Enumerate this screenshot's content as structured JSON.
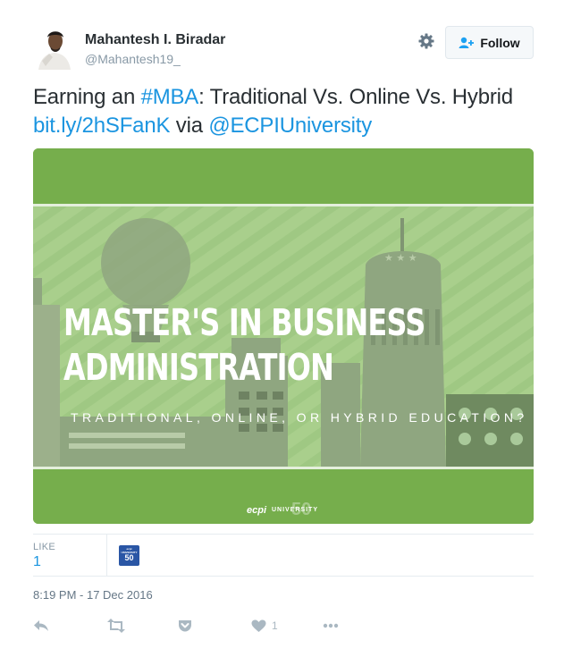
{
  "user": {
    "name": "Mahantesh I. Biradar",
    "handle": "@Mahantesh19_"
  },
  "header": {
    "follow_label": "Follow",
    "settings_icon": "gear-icon",
    "follow_icon": "add-user-icon"
  },
  "tweet": {
    "text_1": "Earning an ",
    "hashtag": "#MBA",
    "text_2": ": Traditional Vs. Online Vs. Hybrid ",
    "url": "bit.ly/2hSFanK",
    "text_3": " via ",
    "mention": "@ECPIUniversity"
  },
  "card": {
    "title_line1": "MASTER'S IN BUSINESS",
    "title_line2": "ADMINISTRATION",
    "subtitle": "TRADITIONAL, ONLINE, OR HYBRID EDUCATION?",
    "brand": "ecpi",
    "brand_sub": "UNIVERSITY",
    "brand_50": "50",
    "bg_color": "#76ae4c",
    "panel_color": "#a7cf8b"
  },
  "stats": {
    "like_label": "LIKE",
    "like_count": "1",
    "liker_badge_text": "ecpi UNIVERSITY",
    "liker_badge": "50"
  },
  "timestamp": "8:19 PM - 17 Dec 2016",
  "actions": {
    "reply_icon": "reply-icon",
    "retweet_icon": "retweet-icon",
    "pocket_icon": "pocket-icon",
    "like_icon": "heart-icon",
    "like_count": "1",
    "more_icon": "more-icon"
  },
  "colors": {
    "link": "#1b95e0",
    "muted": "#8899a6",
    "action": "#aab8c2"
  }
}
